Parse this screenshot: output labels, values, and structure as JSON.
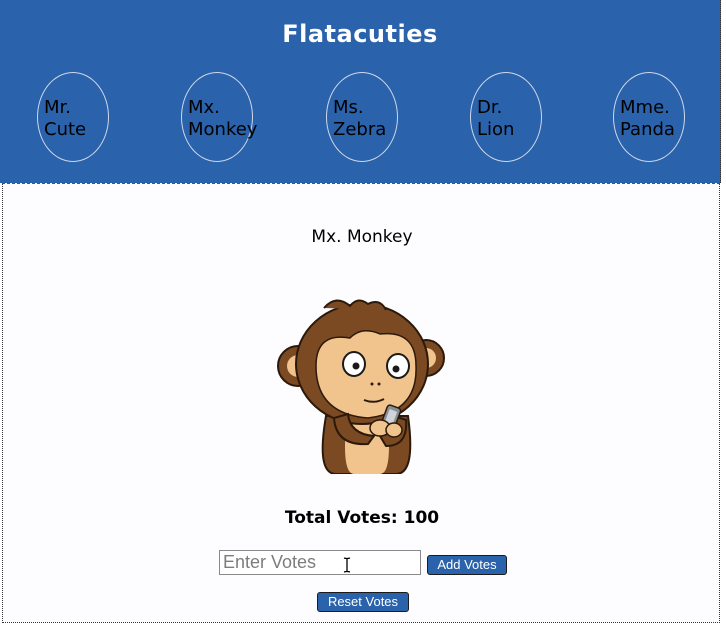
{
  "header": {
    "title": "Flatacuties",
    "characters": [
      {
        "line1": "Mr.",
        "line2": "Cute"
      },
      {
        "line1": "Mx.",
        "line2": "Monkey"
      },
      {
        "line1": "Ms.",
        "line2": "Zebra"
      },
      {
        "line1": "Dr.",
        "line2": "Lion"
      },
      {
        "line1": "Mme.",
        "line2": "Panda"
      }
    ]
  },
  "detail": {
    "name": "Mx. Monkey",
    "image_icon": "monkey-illustration",
    "votes_text": "Total Votes: 100",
    "input_placeholder": "Enter Votes",
    "input_value": "",
    "add_button": "Add Votes",
    "reset_button": "Reset Votes"
  },
  "colors": {
    "header_bg": "#2a62ab",
    "button_bg": "#2a62ab"
  }
}
